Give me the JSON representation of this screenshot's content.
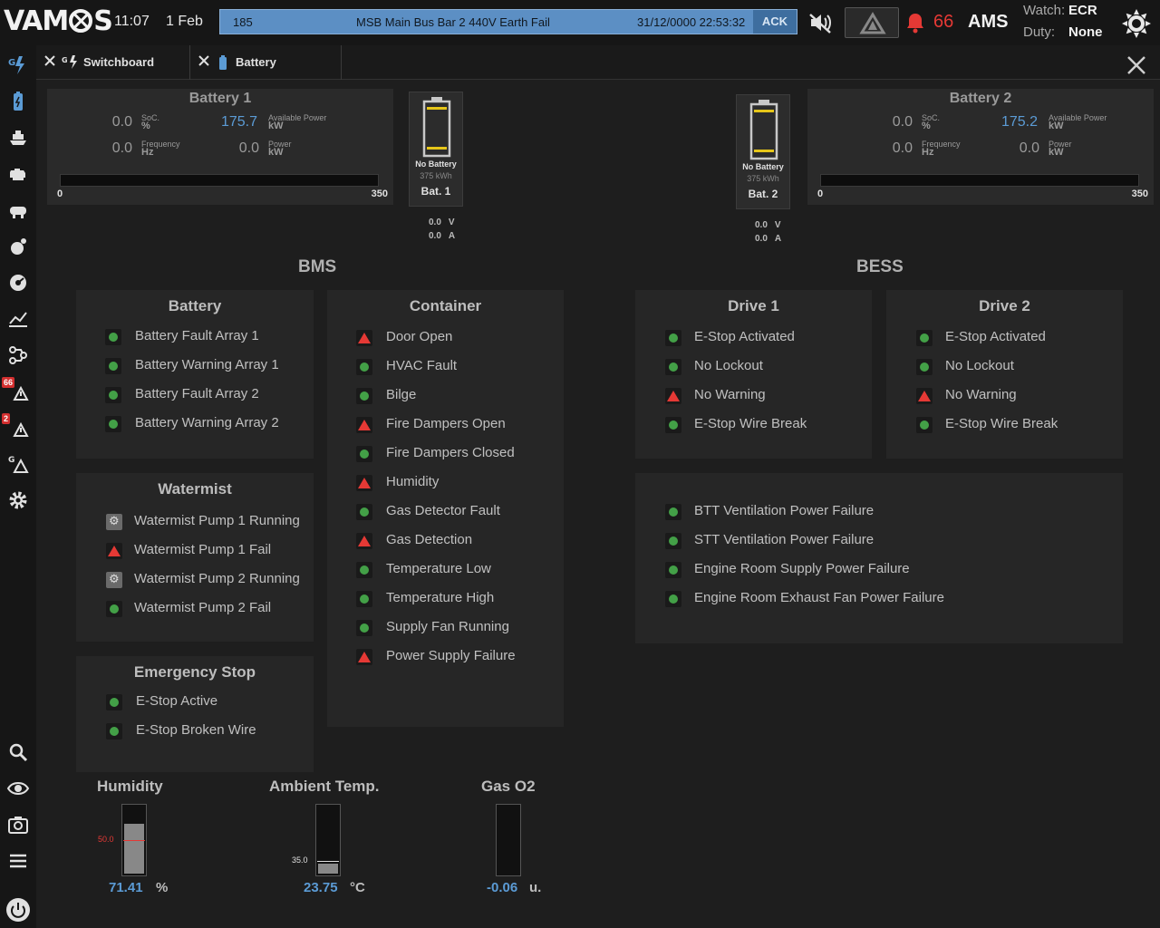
{
  "header": {
    "logo": "VAMOS",
    "time": "11:07",
    "date": "1 Feb",
    "alarm": {
      "id": "185",
      "text": "MSB Main Bus Bar 2 440V Earth Fail",
      "timestamp": "31/12/0000 22:53:32",
      "ack_label": "ACK"
    },
    "alarm_count": "66",
    "system_label": "AMS",
    "watch_label": "Watch:",
    "watch_value": "ECR",
    "duty_label": "Duty:",
    "duty_value": "None"
  },
  "sidebar": {
    "badges": {
      "alarms": "66",
      "warnings": "2"
    },
    "icons": [
      "switchboard-icon",
      "battery-icon",
      "ship-icon",
      "engine-icon",
      "pump-icon",
      "fuel-icon",
      "fan-icon",
      "trend-icon",
      "network-icon",
      "alarm-list-icon",
      "warning-list-icon",
      "generator-alarm-icon",
      "settings-icon",
      "search-icon",
      "eye-icon",
      "camera-icon",
      "menu-icon",
      "power-icon"
    ]
  },
  "tabs": [
    {
      "label": "Switchboard"
    },
    {
      "label": "Battery"
    }
  ],
  "battery1": {
    "title": "Battery 1",
    "soc_value": "0.0",
    "soc_label": "SoC.",
    "soc_unit": "%",
    "avail_value": "175.7",
    "avail_label": "Available Power",
    "avail_unit": "kW",
    "freq_value": "0.0",
    "freq_label": "Frequency",
    "freq_unit": "Hz",
    "power_value": "0.0",
    "power_label": "Power",
    "power_unit": "kW",
    "bar_min": "0",
    "bar_max": "350",
    "bar_fill": 0,
    "cell_status": "No Battery",
    "cell_capacity": "375 kWh",
    "cell_name": "Bat. 1",
    "voltage": "0.0",
    "voltage_unit": "V",
    "current": "0.0",
    "current_unit": "A"
  },
  "battery2": {
    "title": "Battery 2",
    "soc_value": "0.0",
    "soc_label": "SoC.",
    "soc_unit": "%",
    "avail_value": "175.2",
    "avail_label": "Available Power",
    "avail_unit": "kW",
    "freq_value": "0.0",
    "freq_label": "Frequency",
    "freq_unit": "Hz",
    "power_value": "0.0",
    "power_label": "Power",
    "power_unit": "kW",
    "bar_min": "0",
    "bar_max": "350",
    "bar_fill": 0,
    "cell_status": "No Battery",
    "cell_capacity": "375 kWh",
    "cell_name": "Bat. 2",
    "voltage": "0.0",
    "voltage_unit": "V",
    "current": "0.0",
    "current_unit": "A"
  },
  "bms": {
    "title": "BMS",
    "battery": {
      "title": "Battery",
      "items": [
        {
          "label": "Battery Fault Array 1",
          "status": "ok"
        },
        {
          "label": "Battery Warning Array 1",
          "status": "ok"
        },
        {
          "label": "Battery Fault Array 2",
          "status": "ok"
        },
        {
          "label": "Battery Warning Array 2",
          "status": "ok"
        }
      ]
    },
    "watermist": {
      "title": "Watermist",
      "items": [
        {
          "label": "Watermist Pump 1 Running",
          "status": "pump"
        },
        {
          "label": "Watermist Pump 1 Fail",
          "status": "warn"
        },
        {
          "label": "Watermist Pump 2 Running",
          "status": "pump"
        },
        {
          "label": "Watermist Pump 2 Fail",
          "status": "ok"
        }
      ]
    },
    "estop": {
      "title": "Emergency Stop",
      "items": [
        {
          "label": "E-Stop Active",
          "status": "ok"
        },
        {
          "label": "E-Stop Broken Wire",
          "status": "ok"
        }
      ]
    },
    "container": {
      "title": "Container",
      "items": [
        {
          "label": "Door Open",
          "status": "warn"
        },
        {
          "label": "HVAC Fault",
          "status": "ok"
        },
        {
          "label": "Bilge",
          "status": "ok"
        },
        {
          "label": "Fire Dampers Open",
          "status": "warn"
        },
        {
          "label": "Fire Dampers Closed",
          "status": "ok"
        },
        {
          "label": "Humidity",
          "status": "warn"
        },
        {
          "label": "Gas Detector Fault",
          "status": "ok"
        },
        {
          "label": "Gas Detection",
          "status": "warn"
        },
        {
          "label": "Temperature Low",
          "status": "ok"
        },
        {
          "label": "Temperature High",
          "status": "ok"
        },
        {
          "label": "Supply Fan Running",
          "status": "ok"
        },
        {
          "label": "Power Supply Failure",
          "status": "warn"
        }
      ]
    }
  },
  "bess": {
    "title": "BESS",
    "drive1": {
      "title": "Drive 1",
      "items": [
        {
          "label": "E-Stop Activated",
          "status": "ok"
        },
        {
          "label": "No Lockout",
          "status": "ok"
        },
        {
          "label": "No Warning",
          "status": "warn"
        },
        {
          "label": "E-Stop Wire Break",
          "status": "ok"
        }
      ]
    },
    "drive2": {
      "title": "Drive 2",
      "items": [
        {
          "label": "E-Stop Activated",
          "status": "ok"
        },
        {
          "label": "No Lockout",
          "status": "ok"
        },
        {
          "label": "No Warning",
          "status": "warn"
        },
        {
          "label": "E-Stop Wire Break",
          "status": "ok"
        }
      ]
    },
    "ventilation": {
      "items": [
        {
          "label": "BTT Ventilation Power Failure",
          "status": "ok"
        },
        {
          "label": "STT Ventilation Power Failure",
          "status": "ok"
        },
        {
          "label": "Engine Room Supply Power Failure",
          "status": "ok"
        },
        {
          "label": "Engine Room Exhaust Fan Power Failure",
          "status": "ok"
        }
      ]
    }
  },
  "gauges": {
    "humidity": {
      "title": "Humidity",
      "value": "71.41",
      "unit": "%",
      "mark": "50.0",
      "fill_fraction": 0.72,
      "mark_fraction": 0.5
    },
    "ambient": {
      "title": "Ambient Temp.",
      "value": "23.75",
      "unit": "°C",
      "mark": "35.0",
      "fill_fraction": 0.14,
      "mark_fraction": 0.2
    },
    "gas": {
      "title": "Gas O2",
      "value": "-0.06",
      "unit": "u.",
      "fill_fraction": 0
    }
  },
  "colors": {
    "ok": "#43a047",
    "warn": "#e53935",
    "value_blue": "#5b9bd5",
    "alarm_bar": "#5c8fc4"
  }
}
